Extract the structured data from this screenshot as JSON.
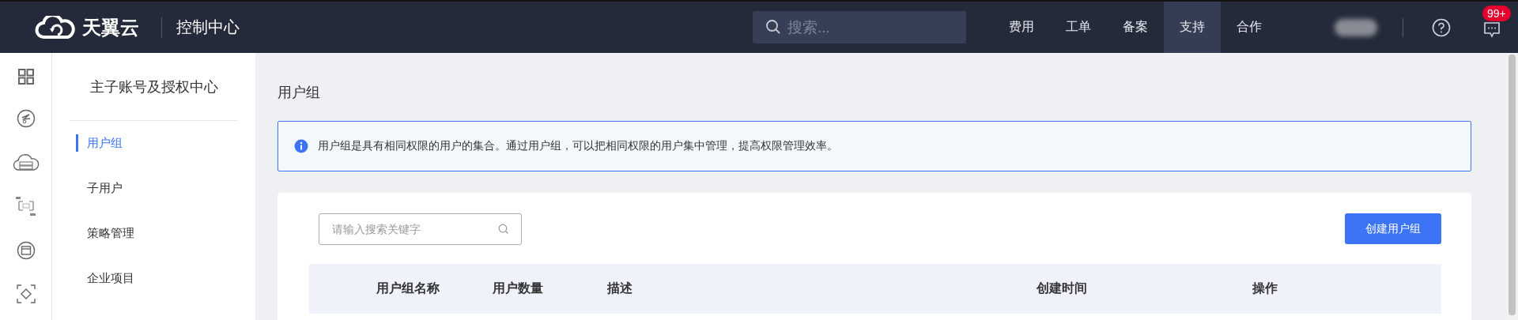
{
  "topbar": {
    "brand": "天翼云",
    "console": "控制中心",
    "search": {
      "placeholder": "搜索..."
    },
    "nav": [
      {
        "label": "费用",
        "selected": false
      },
      {
        "label": "工单",
        "selected": false
      },
      {
        "label": "备案",
        "selected": false
      },
      {
        "label": "支持",
        "selected": true
      },
      {
        "label": "合作",
        "selected": false
      }
    ],
    "badge": "99+"
  },
  "sidebar": {
    "title": "主子账号及授权中心",
    "items": [
      {
        "label": "用户组",
        "selected": true
      },
      {
        "label": "子用户",
        "selected": false
      },
      {
        "label": "策略管理",
        "selected": false
      },
      {
        "label": "企业项目",
        "selected": false
      }
    ]
  },
  "page": {
    "title": "用户组",
    "notice": "用户组是具有相同权限的用户的集合。通过用户组，可以把相同权限的用户集中管理，提高权限管理效率。",
    "search": {
      "placeholder": "请输入搜索关键字"
    },
    "create_button": "创建用户组",
    "table": {
      "columns": [
        "用户组名称",
        "用户数量",
        "描述",
        "创建时间",
        "操作"
      ]
    }
  }
}
